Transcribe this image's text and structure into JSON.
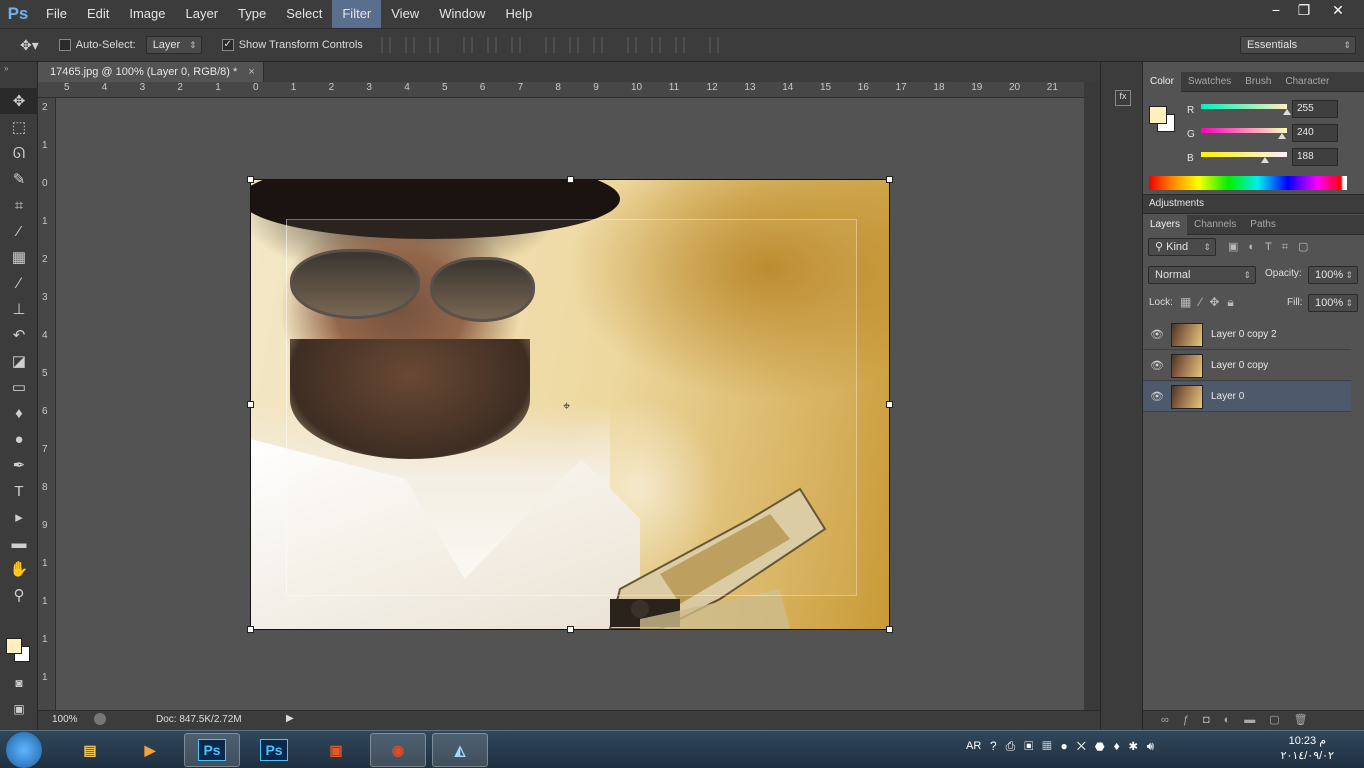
{
  "app": {
    "logo": "Ps"
  },
  "menu": [
    "File",
    "Edit",
    "Image",
    "Layer",
    "Type",
    "Select",
    "Filter",
    "View",
    "Window",
    "Help"
  ],
  "window_controls": {
    "minimize": "−",
    "restore": "❐",
    "close": "✕"
  },
  "options": {
    "auto_select_label": "Auto-Select:",
    "auto_select_target": "Layer",
    "show_transform_label": "Show Transform Controls",
    "show_transform_checked": "✓",
    "workspace": "Essentials"
  },
  "tools": [
    {
      "name": "move-tool",
      "glyph": "✥"
    },
    {
      "name": "marquee-tool",
      "glyph": "⬚"
    },
    {
      "name": "lasso-tool",
      "glyph": "ᘏ"
    },
    {
      "name": "quick-select-tool",
      "glyph": "✎"
    },
    {
      "name": "crop-tool",
      "glyph": "⌗"
    },
    {
      "name": "eyedropper-tool",
      "glyph": "⁄"
    },
    {
      "name": "healing-tool",
      "glyph": "▦"
    },
    {
      "name": "brush-tool",
      "glyph": "∕"
    },
    {
      "name": "stamp-tool",
      "glyph": "⊥"
    },
    {
      "name": "history-brush-tool",
      "glyph": "↶"
    },
    {
      "name": "eraser-tool",
      "glyph": "◪"
    },
    {
      "name": "gradient-tool",
      "glyph": "▭"
    },
    {
      "name": "blur-tool",
      "glyph": "♦"
    },
    {
      "name": "dodge-tool",
      "glyph": "●"
    },
    {
      "name": "pen-tool",
      "glyph": "✒"
    },
    {
      "name": "type-tool",
      "glyph": "T"
    },
    {
      "name": "path-select-tool",
      "glyph": "▸"
    },
    {
      "name": "shape-tool",
      "glyph": "▬"
    },
    {
      "name": "hand-tool",
      "glyph": "✋"
    },
    {
      "name": "zoom-tool",
      "glyph": "⚲"
    }
  ],
  "document": {
    "tab_title": "17465.jpg @ 100% (Layer 0, RGB/8) *",
    "tab_close": "×",
    "zoom": "100%",
    "doc_info": "Doc: 847.5K/2.72M",
    "ruler_h": [
      "5",
      "4",
      "3",
      "2",
      "1",
      "0",
      "1",
      "2",
      "3",
      "4",
      "5",
      "6",
      "7",
      "8",
      "9",
      "10",
      "11",
      "12",
      "13",
      "14",
      "15",
      "16",
      "17",
      "18",
      "19",
      "20",
      "21"
    ],
    "ruler_v": [
      "2",
      "1",
      "0",
      "1",
      "2",
      "3",
      "4",
      "5",
      "6",
      "7",
      "8",
      "9",
      "1",
      "1",
      "1",
      "1",
      "1"
    ]
  },
  "colors": {
    "foreground": "#fff0bc",
    "background": "#ffffff"
  },
  "color_panel": {
    "tabs": [
      "Color",
      "Swatches",
      "Brush",
      "Character"
    ],
    "r_label": "R",
    "r_value": "255",
    "g_label": "G",
    "g_value": "240",
    "b_label": "B",
    "b_value": "188",
    "r_fill": 1.0,
    "g_fill": 0.94,
    "b_fill": 0.74
  },
  "adjustments": {
    "title": "Adjustments"
  },
  "layers_panel": {
    "tabs": [
      "Layers",
      "Channels",
      "Paths"
    ],
    "kind": "Kind",
    "blend_mode": "Normal",
    "opacity_label": "Opacity:",
    "opacity_value": "100%",
    "lock_label": "Lock:",
    "fill_label": "Fill:",
    "fill_value": "100%",
    "layers": [
      {
        "name": "Layer 0 copy 2",
        "selected": false
      },
      {
        "name": "Layer 0 copy",
        "selected": false
      },
      {
        "name": "Layer 0",
        "selected": true
      }
    ]
  },
  "taskbar": {
    "apps": [
      "Explorer",
      "Media Player",
      "Ps",
      "Ps",
      "Office",
      "Chrome",
      "Notes"
    ],
    "language": "AR",
    "time": "10:23 م",
    "date": "٢٠١٤/٠٩/٠٢"
  }
}
